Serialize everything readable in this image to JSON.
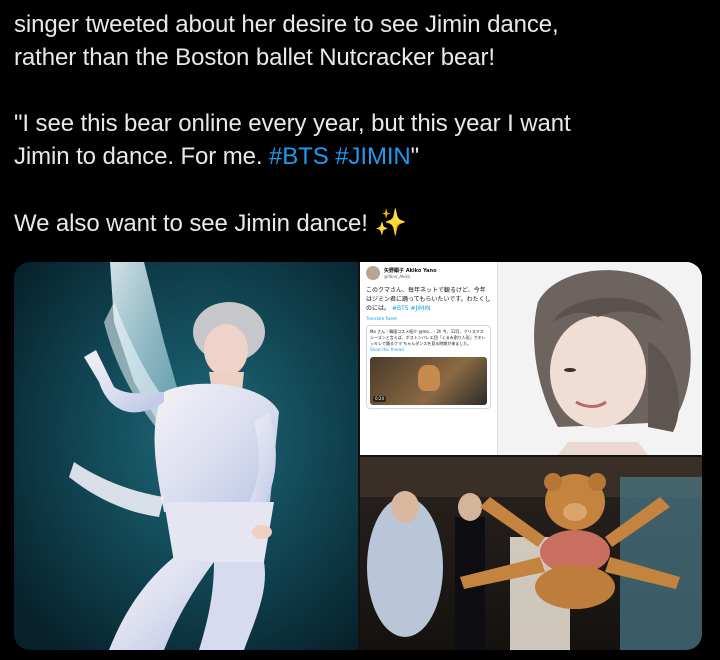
{
  "tweet": {
    "line1": "singer tweeted about her desire to see Jimin dance,",
    "line2": "rather than the Boston ballet Nutcracker bear!",
    "quote_part1": "\"I see this bear online every year, but this year I want",
    "quote_part2": "Jimin to dance. For me. ",
    "hashtag1": "#BTS",
    "hashtag2": "#JIMIN",
    "quote_end": "\"",
    "closing": "We also want to see Jimin dance! ",
    "sparkle_icon": "✨"
  },
  "embedded_tweet": {
    "name": "矢野顕子 Akiko Yano",
    "handle": "@Yano_Akiko",
    "body": "このクマさん、毎年ネットで観るけど、今年はジミン君に踊ってもらいたいです。わたくしのには。",
    "tags": "#BTS #JIMIN",
    "translate": "Translate Tweet",
    "quoted": "Mo さん｜韓国コスメ紹介 @mo... · 2h 今、12月、クリスマスシーズンと言えば、ボストンバレエ団「くるみ割り人形」でキレッキレで踊るクマ ちゃんダンスを見る時期が来ました。",
    "show_thread": "Show this thread",
    "duration": "0:24"
  },
  "colors": {
    "background": "#000000",
    "text": "#e7e9ea",
    "hashtag": "#1d9bf0"
  }
}
